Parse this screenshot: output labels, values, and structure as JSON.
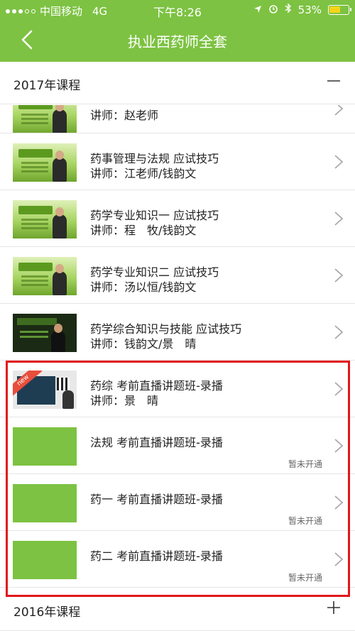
{
  "status_bar": {
    "carrier": "中国移动",
    "network": "4G",
    "time": "下午8:26",
    "battery": "53%",
    "battery_level": 0.53
  },
  "navbar": {
    "title": "执业西药师全套"
  },
  "sections": [
    {
      "label": "2017年课程",
      "toggle": "collapse-icon"
    },
    {
      "label": "2016年课程",
      "toggle": "expand-icon"
    }
  ],
  "courses": [
    {
      "title": "",
      "teacher": "讲师：赵老师",
      "status": ""
    },
    {
      "title": "药事管理与法规 应试技巧",
      "teacher": "讲师：江老师/钱韵文",
      "status": ""
    },
    {
      "title": "药学专业知识一 应试技巧",
      "teacher": "讲师：程　牧/钱韵文",
      "status": ""
    },
    {
      "title": "药学专业知识二 应试技巧",
      "teacher": "讲师：汤以恒/钱韵文",
      "status": ""
    },
    {
      "title": "药学综合知识与技能 应试技巧",
      "teacher": "讲师：钱韵文/景　晴",
      "status": ""
    },
    {
      "title": "药综 考前直播讲题班-录播",
      "teacher": "讲师：景　晴",
      "status": "",
      "badge": "new"
    },
    {
      "title": "法规 考前直播讲题班-录播",
      "teacher": "",
      "status": "暂未开通"
    },
    {
      "title": "药一 考前直播讲题班-录播",
      "teacher": "",
      "status": "暂未开通"
    },
    {
      "title": "药二 考前直播讲题班-录播",
      "teacher": "",
      "status": "暂未开通"
    }
  ],
  "colors": {
    "brand_green": "#7dc242",
    "highlight_red": "#e2161b"
  }
}
